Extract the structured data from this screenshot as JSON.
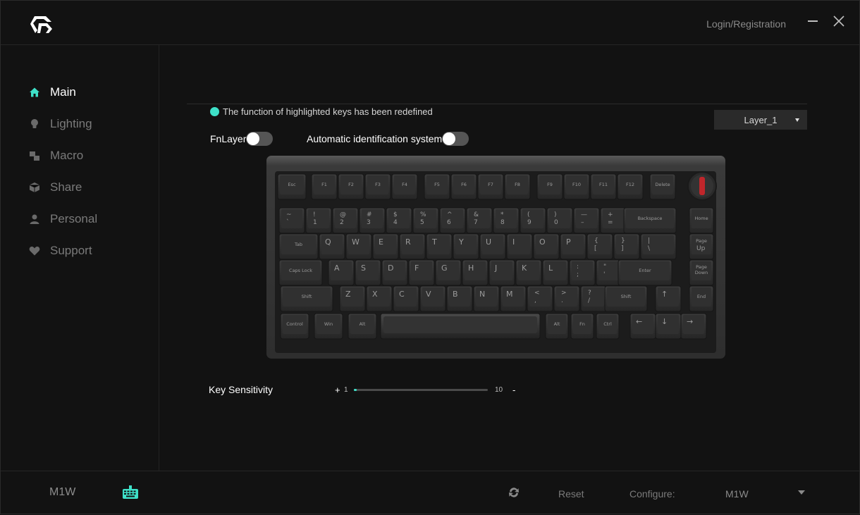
{
  "header": {
    "login": "Login/Registration"
  },
  "sidebar": {
    "items": [
      {
        "label": "Main",
        "icon": "home-icon",
        "active": true
      },
      {
        "label": "Lighting",
        "icon": "bulb-icon"
      },
      {
        "label": "Macro",
        "icon": "macro-icon"
      },
      {
        "label": "Share",
        "icon": "cube-icon"
      },
      {
        "label": "Personal",
        "icon": "person-icon"
      },
      {
        "label": "Support",
        "icon": "heart-icon"
      }
    ]
  },
  "main": {
    "notice": "The function of highlighted keys has been redefined",
    "layer": "Layer_1",
    "fnlayer_label": "FnLayer",
    "auto_label": "Automatic identification system",
    "sensitivity": {
      "label": "Key Sensitivity",
      "plus": "+",
      "minus": "-",
      "min": "1",
      "max": "10",
      "value": 1
    }
  },
  "keyboard": {
    "rows": [
      [
        [
          "Esc"
        ],
        [
          "F1"
        ],
        [
          "F2"
        ],
        [
          "F3"
        ],
        [
          "F4"
        ],
        [
          "F5"
        ],
        [
          "F6"
        ],
        [
          "F7"
        ],
        [
          "F8"
        ],
        [
          "F9"
        ],
        [
          "F10"
        ],
        [
          "F11"
        ],
        [
          "F12"
        ],
        [
          "Delete"
        ]
      ],
      [
        [
          "~",
          "`"
        ],
        [
          "!",
          "1"
        ],
        [
          "@",
          "2"
        ],
        [
          "#",
          "3"
        ],
        [
          "$",
          "4"
        ],
        [
          "%",
          "5"
        ],
        [
          "^",
          "6"
        ],
        [
          "&",
          "7"
        ],
        [
          "*",
          "8"
        ],
        [
          "(",
          "9"
        ],
        [
          ")",
          "0"
        ],
        [
          "—",
          "–"
        ],
        [
          "+",
          "="
        ],
        [
          "Backspace"
        ],
        [
          "Home"
        ]
      ],
      [
        [
          "Tab"
        ],
        [
          "Q"
        ],
        [
          "W"
        ],
        [
          "E"
        ],
        [
          "R"
        ],
        [
          "T"
        ],
        [
          "Y"
        ],
        [
          "U"
        ],
        [
          "I"
        ],
        [
          "O"
        ],
        [
          "P"
        ],
        [
          "{",
          "["
        ],
        [
          "}",
          "]"
        ],
        [
          "|",
          "\\"
        ],
        [
          "Page",
          "Up"
        ]
      ],
      [
        [
          "Caps Lock"
        ],
        [
          "A"
        ],
        [
          "S"
        ],
        [
          "D"
        ],
        [
          "F"
        ],
        [
          "G"
        ],
        [
          "H"
        ],
        [
          "J"
        ],
        [
          "K"
        ],
        [
          "L"
        ],
        [
          ":",
          ";"
        ],
        [
          "\"",
          "'"
        ],
        [
          "Enter"
        ],
        [
          "Page",
          "Down"
        ]
      ],
      [
        [
          "Shift"
        ],
        [
          "Z"
        ],
        [
          "X"
        ],
        [
          "C"
        ],
        [
          "V"
        ],
        [
          "B"
        ],
        [
          "N"
        ],
        [
          "M"
        ],
        [
          "<",
          ","
        ],
        [
          ">",
          "."
        ],
        [
          "?",
          "/"
        ],
        [
          "Shift"
        ],
        [
          "↑"
        ],
        [
          "End"
        ]
      ],
      [
        [
          "Control"
        ],
        [
          "Win"
        ],
        [
          "Alt"
        ],
        [
          ""
        ],
        [
          "Alt"
        ],
        [
          "Fn"
        ],
        [
          "Ctrl"
        ],
        [
          "←"
        ],
        [
          "↓"
        ],
        [
          "→"
        ]
      ]
    ]
  },
  "footer": {
    "model": "M1W",
    "reset": "Reset",
    "configure": "Configure:",
    "config_value": "M1W"
  },
  "colors": {
    "accent": "#3ee0c8",
    "background": "#121212",
    "knob": "#c0262b"
  }
}
